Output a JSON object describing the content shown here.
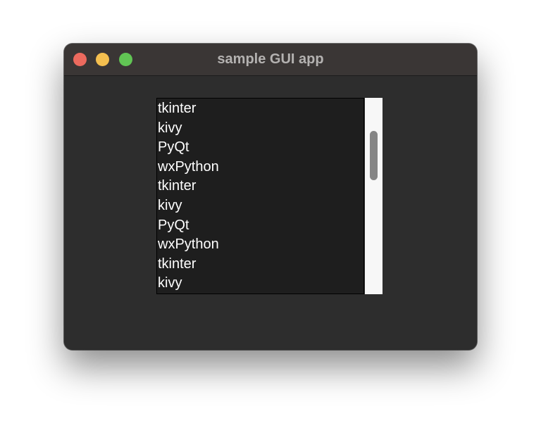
{
  "window": {
    "title": "sample GUI app",
    "controls": [
      {
        "name": "close",
        "color": "#ec6a5e"
      },
      {
        "name": "minimize",
        "color": "#f4bf4f"
      },
      {
        "name": "zoom",
        "color": "#61c554"
      }
    ]
  },
  "listbox": {
    "items": [
      "tkinter",
      "kivy",
      "PyQt",
      "wxPython",
      "tkinter",
      "kivy",
      "PyQt",
      "wxPython",
      "tkinter",
      "kivy"
    ],
    "scroll_fraction": 0.2
  }
}
